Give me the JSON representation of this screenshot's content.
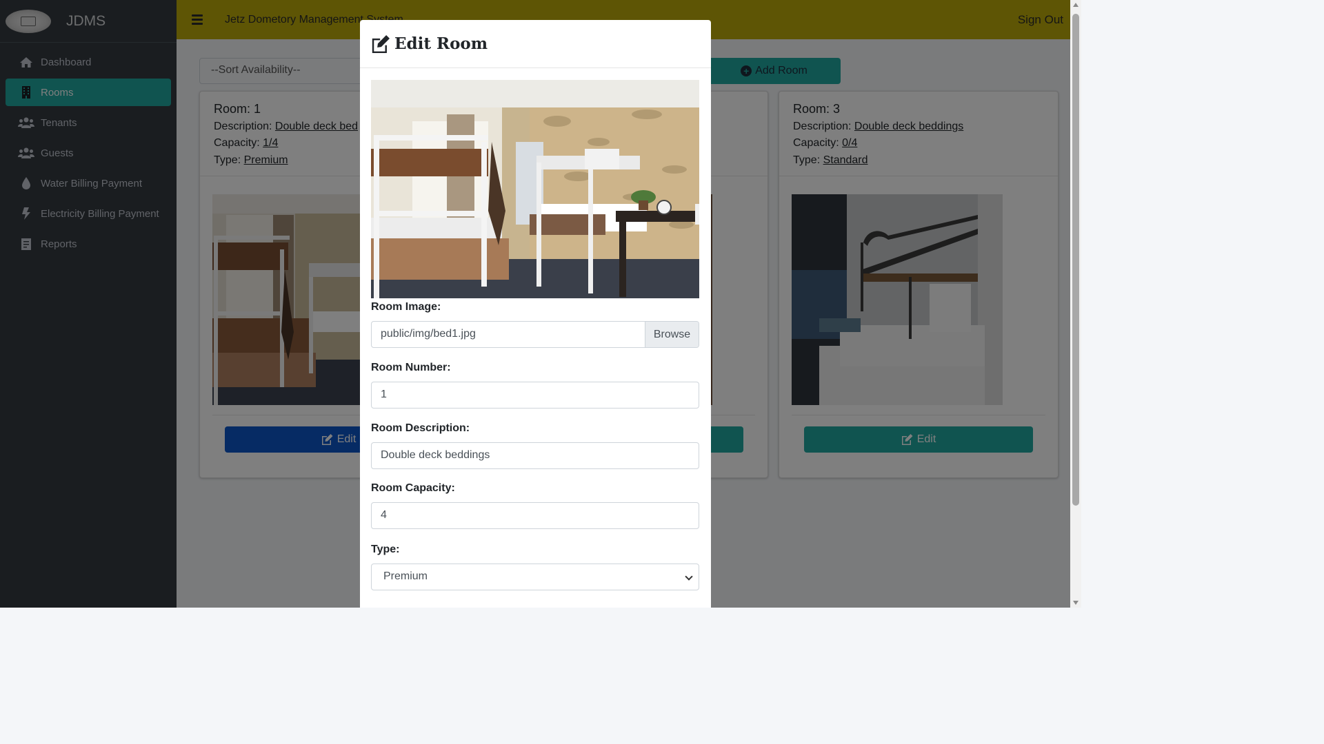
{
  "app": {
    "brand": "JDMS",
    "header_title": "Jetz Dometory Management System",
    "sign_out": "Sign Out"
  },
  "sidebar": {
    "items": [
      {
        "label": "Dashboard",
        "icon": "home-icon",
        "active": false
      },
      {
        "label": "Rooms",
        "icon": "building-icon",
        "active": true
      },
      {
        "label": "Tenants",
        "icon": "users-icon",
        "active": false
      },
      {
        "label": "Guests",
        "icon": "users-icon",
        "active": false
      },
      {
        "label": "Water Billing Payment",
        "icon": "water-drop-icon",
        "active": false
      },
      {
        "label": "Electricity Billing Payment",
        "icon": "bolt-icon",
        "active": false
      },
      {
        "label": "Reports",
        "icon": "report-icon",
        "active": false
      }
    ]
  },
  "toolbar": {
    "sort_placeholder": "--Sort Availability--",
    "add_room": "Add Room"
  },
  "cards": [
    {
      "room_prefix": "Room: ",
      "room": "1",
      "desc_prefix": "Description: ",
      "description": "Double deck bed",
      "cap_prefix": "Capacity: ",
      "capacity": "1/4",
      "type_prefix": "Type: ",
      "type": "Premium",
      "edit": "Edit"
    },
    {
      "room_prefix": "Room: ",
      "room": "3",
      "desc_prefix": "Description: ",
      "description": "Double deck beddings",
      "cap_prefix": "Capacity: ",
      "capacity": "0/4",
      "type_prefix": "Type: ",
      "type": "Standard",
      "edit": "Edit"
    }
  ],
  "modal": {
    "title": "Edit Room",
    "image_label": "Room Image:",
    "image_value": "public/img/bed1.jpg",
    "browse": "Browse",
    "number_label": "Room Number:",
    "number_value": "1",
    "desc_label": "Room Description:",
    "desc_value": "Double deck beddings",
    "capacity_label": "Room Capacity:",
    "capacity_value": "4",
    "type_label": "Type:",
    "type_value": "Premium"
  },
  "colors": {
    "header": "#bcab0a",
    "sidebar": "#343a40",
    "accent": "#20a8a0",
    "primary": "#0d56c8"
  }
}
